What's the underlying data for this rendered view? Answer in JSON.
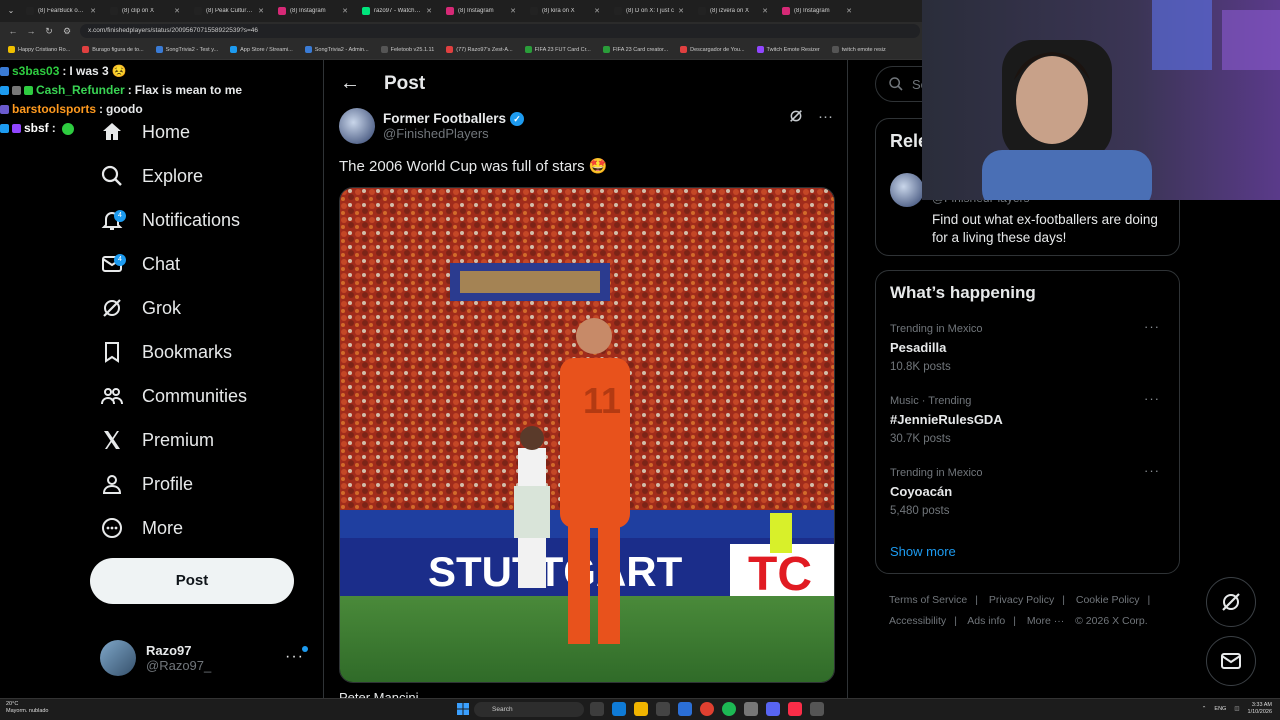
{
  "browser": {
    "tabs": [
      {
        "title": "(8) FearBuck on X",
        "color": "#222"
      },
      {
        "title": "(8) clip on X",
        "color": "#222"
      },
      {
        "title": "(8) Peak Culture on X",
        "color": "#222"
      },
      {
        "title": "(8) Instagram",
        "color": "#d62976"
      },
      {
        "title": "razo97 - Watch clip",
        "color": "#00e47c"
      },
      {
        "title": "(8) Instagram",
        "color": "#d62976"
      },
      {
        "title": "(8) kira on X",
        "color": "#222"
      },
      {
        "title": "(8) D on X: I just c",
        "color": "#222"
      },
      {
        "title": "(8) izvera on X",
        "color": "#222"
      },
      {
        "title": "(8) Instagram",
        "color": "#d62976"
      }
    ],
    "url": "x.com/finishedplayers/status/2009567071558922539?s=46",
    "bookmarks": [
      {
        "label": "Happy Cristiano Ro...",
        "color": "#f0c000"
      },
      {
        "label": "Burago figura de to...",
        "color": "#e04040"
      },
      {
        "label": "SongTrivia2 - Test y...",
        "color": "#3a7bd5"
      },
      {
        "label": "App Store / Streami...",
        "color": "#1d9bf0"
      },
      {
        "label": "SongTrivia2 - Admin...",
        "color": "#3a7bd5"
      },
      {
        "label": "Feletoob v25.1.11",
        "color": "#555"
      },
      {
        "label": "(77) Razo97's Zest-A...",
        "color": "#e04040"
      },
      {
        "label": "FIFA 23 FUT Card Cr...",
        "color": "#2a9d3a"
      },
      {
        "label": "FIFA 23 Card creator...",
        "color": "#2a9d3a"
      },
      {
        "label": "Descargador de You...",
        "color": "#e04040"
      },
      {
        "label": "Twitch Emote Resizer",
        "color": "#9146ff"
      },
      {
        "label": "twitch emote resiz",
        "color": "#555"
      }
    ]
  },
  "chat": [
    {
      "user": "s3bas03",
      "user_color": "#2ecc40",
      "msg": "I was 3"
    },
    {
      "user": "Cash_Refunder",
      "user_color": "#39d353",
      "msg": "Flax is mean to me"
    },
    {
      "user": "barstoolsports",
      "user_color": "#ff9a1f",
      "msg": "goodo"
    },
    {
      "user": "sbsf",
      "user_color": "#ffffff",
      "msg": ""
    }
  ],
  "nav": {
    "items": [
      {
        "label": "Home"
      },
      {
        "label": "Explore"
      },
      {
        "label": "Notifications",
        "badge": "4"
      },
      {
        "label": "Chat",
        "badge": "4"
      },
      {
        "label": "Grok"
      },
      {
        "label": "Bookmarks"
      },
      {
        "label": "Communities"
      },
      {
        "label": "Premium"
      },
      {
        "label": "Profile"
      },
      {
        "label": "More"
      }
    ],
    "post_button": "Post",
    "account": {
      "name": "Razo97",
      "handle": "@Razo97_"
    }
  },
  "post": {
    "header": "Post",
    "author_name": "Former Footballers",
    "author_handle": "@FinishedPlayers",
    "text": "The 2006 World Cup was full of stars 🤩",
    "media_text": "STUTTGART",
    "jersey_number": "11",
    "below_text": "Peter Mancini"
  },
  "right": {
    "search_placeholder": "Search",
    "relevant_title": "Relevant people",
    "relevant_handle": "@FinishedPlayers",
    "relevant_desc": "Find out what ex-footballers are doing for a living these days!",
    "happening_title": "What’s happening",
    "trends": [
      {
        "context": "Trending in Mexico",
        "name": "Pesadilla",
        "count": "10.8K posts"
      },
      {
        "context": "Music · Trending",
        "name": "#JennieRulesGDA",
        "count": "30.7K posts"
      },
      {
        "context": "Trending in Mexico",
        "name": "Coyoacán",
        "count": "5,480 posts"
      }
    ],
    "show_more": "Show more",
    "footer": [
      "Terms of Service",
      "Privacy Policy",
      "Cookie Policy",
      "Accessibility",
      "Ads info",
      "More ···",
      "© 2026 X Corp."
    ]
  },
  "taskbar": {
    "weather_temp": "20°C",
    "weather_desc": "Mayorm. nublado",
    "search": "Search",
    "lang": "ENG",
    "time": "3:33 AM",
    "date": "1/10/2026"
  },
  "colors": {
    "accent": "#1d9bf0",
    "background": "#000000",
    "border": "#2f3336",
    "muted": "#71767b"
  }
}
